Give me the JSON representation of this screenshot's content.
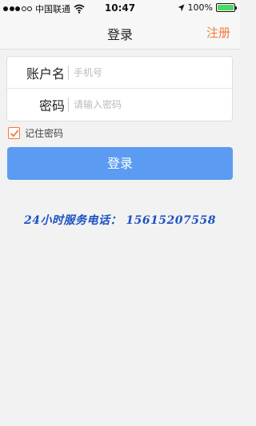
{
  "status_bar": {
    "carrier": "中国联通",
    "time": "10:47",
    "battery": "100%",
    "battery_level": 1.0
  },
  "nav": {
    "title": "登录",
    "register_label": "注册"
  },
  "form": {
    "account_label": "账户名",
    "account_placeholder": "手机号",
    "account_value": "",
    "password_label": "密码",
    "password_placeholder": "请输入密码",
    "password_value": ""
  },
  "remember": {
    "label": "记住密码",
    "checked": true
  },
  "login_button": "登录",
  "hotline": "24小时服务电话：  15615207558",
  "colors": {
    "accent": "#f07a3b",
    "button": "#5b9cf2",
    "hotline": "#1a52c4"
  }
}
